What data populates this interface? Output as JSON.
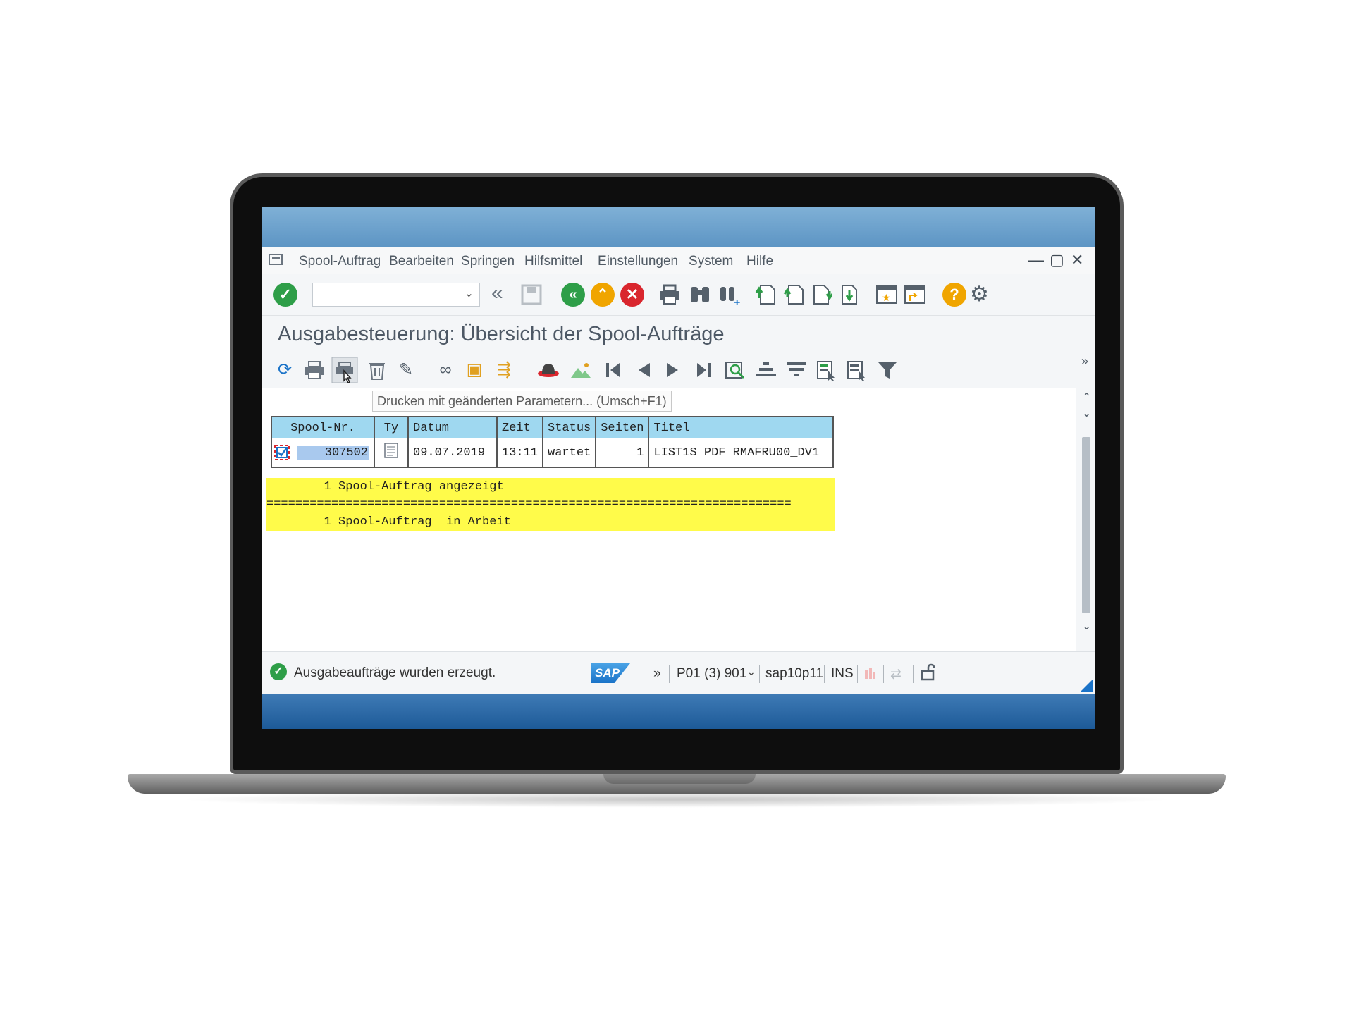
{
  "menu": {
    "items": [
      {
        "pre": "Sp",
        "u": "o",
        "post": "ol-Auftrag"
      },
      {
        "pre": "",
        "u": "B",
        "post": "earbeiten"
      },
      {
        "pre": "",
        "u": "S",
        "post": "pringen"
      },
      {
        "pre": "Hilfs",
        "u": "m",
        "post": "ittel"
      },
      {
        "pre": "",
        "u": "E",
        "post": "instellungen"
      },
      {
        "pre": "S",
        "u": "y",
        "post": "stem"
      },
      {
        "pre": "",
        "u": "H",
        "post": "ilfe"
      }
    ]
  },
  "window_controls": {
    "minimize": "—",
    "maximize": "▢",
    "close": "✕"
  },
  "command_field": {
    "value": ""
  },
  "page_title": "Ausgabesteuerung: Übersicht der Spool-Aufträge",
  "tooltip": "Drucken mit geänderten Parametern...  (Umsch+F1)",
  "table": {
    "headers": [
      "Spool-Nr.",
      "Ty",
      "Datum",
      "Zeit",
      "Status",
      "Seiten",
      "Titel"
    ],
    "row": {
      "spool_nr": "307502",
      "datum": "09.07.2019",
      "zeit": "13:11",
      "status": "wartet",
      "seiten": "1",
      "titel": "LIST1S PDF RMAFRU00_DV1"
    }
  },
  "summary": {
    "line1": "        1 Spool-Auftrag angezeigt",
    "separator": "=========================================================================",
    "line2": "        1 Spool-Auftrag  in Arbeit"
  },
  "statusbar": {
    "message": "Ausgabeaufträge wurden erzeugt.",
    "sap_logo": "SAP",
    "expand": "»",
    "system": "P01 (3) 901",
    "server": "sap10p11",
    "mode": "INS"
  },
  "colors": {
    "accent_blue": "#1a73c8",
    "header_cyan": "#9fd8f0",
    "highlight_yellow": "#fffb4a",
    "ok_green": "#2e9e48",
    "cancel_red": "#d9262e",
    "help_orange": "#f0a500"
  },
  "icons": {
    "toolbar1": [
      "enter-check-icon",
      "back-double-arrow-icon",
      "save-icon",
      "back-icon",
      "exit-icon",
      "cancel-icon",
      "print-icon",
      "find-icon",
      "find-next-icon",
      "first-page-icon",
      "previous-page-icon",
      "next-page-icon",
      "last-page-icon",
      "new-session-icon",
      "shortcut-icon",
      "help-icon",
      "settings-gear-icon"
    ],
    "toolbar2": [
      "refresh-icon",
      "print-icon",
      "print-changed-params-icon",
      "delete-icon",
      "edit-icon",
      "display-glasses-icon",
      "output-icon",
      "export-icon",
      "hat-icon",
      "image-icon",
      "first-icon",
      "previous-icon",
      "next-icon",
      "last-icon",
      "find-icon",
      "align-icon",
      "filter-list-icon",
      "select-icon",
      "select-block-icon",
      "filter-icon"
    ]
  }
}
